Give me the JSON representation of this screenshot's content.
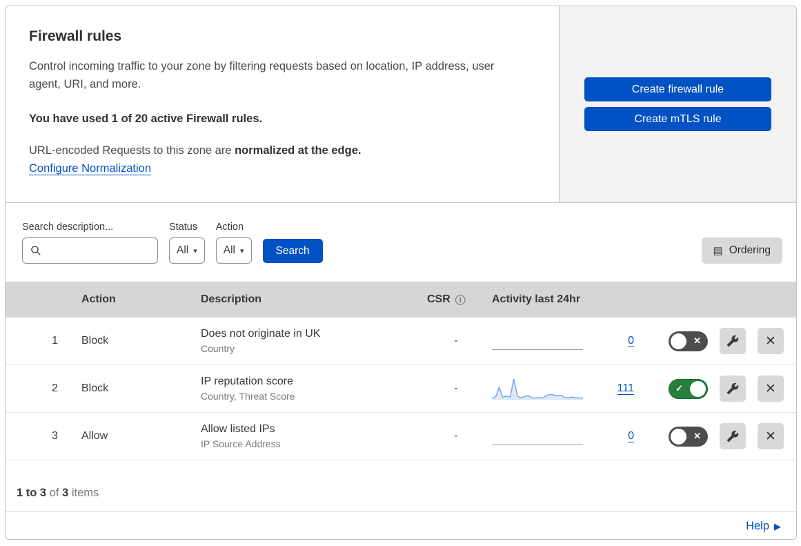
{
  "header": {
    "title": "Firewall rules",
    "description": "Control incoming traffic to your zone by filtering requests based on location, IP address, user agent, URI, and more.",
    "usage_note": "You have used 1 of 20 active Firewall rules.",
    "normalization_prefix": "URL-encoded Requests to this zone are ",
    "normalization_bold": "normalized at the edge.",
    "normalization_link": "Configure Normalization",
    "create_firewall_button": "Create firewall rule",
    "create_mtls_button": "Create mTLS rule"
  },
  "filters": {
    "search_label": "Search description...",
    "status_label": "Status",
    "status_value": "All",
    "action_label": "Action",
    "action_value": "All",
    "search_button": "Search",
    "ordering_button": "Ordering"
  },
  "table": {
    "columns": {
      "action": "Action",
      "description": "Description",
      "csr": "CSR",
      "activity": "Activity last 24hr"
    },
    "rows": [
      {
        "index": "1",
        "action": "Block",
        "description": "Does not originate in UK",
        "criteria": "Country",
        "csr": "-",
        "activity_count": "0",
        "enabled": false
      },
      {
        "index": "2",
        "action": "Block",
        "description": "IP reputation score",
        "criteria": "Country, Threat Score",
        "csr": "-",
        "activity_count": "111",
        "enabled": true
      },
      {
        "index": "3",
        "action": "Allow",
        "description": "Allow listed IPs",
        "criteria": "IP Source Address",
        "csr": "-",
        "activity_count": "0",
        "enabled": false
      }
    ],
    "summary": {
      "range": "1 to 3",
      "of": "of",
      "total": "3",
      "items": "items"
    }
  },
  "footer": {
    "help_label": "Help"
  },
  "chart_data": {
    "type": "area",
    "title": "Activity last 24hr sparkline (rule 2: IP reputation score)",
    "values": [
      4,
      10,
      58,
      8,
      14,
      10,
      100,
      14,
      6,
      12,
      16,
      6,
      4,
      7,
      5,
      17,
      23,
      20,
      16,
      18,
      7,
      5,
      10,
      7,
      5,
      4
    ],
    "total": 111,
    "flat_rows_value": 0
  },
  "icons": {
    "dropdown_arrow": "▾",
    "info": "ⓘ",
    "help_arrow": "▶",
    "toggle_on_check": "✓",
    "toggle_off_cross": "✕",
    "close": "✕",
    "ordering": "▤"
  },
  "colors": {
    "primary_blue": "#0051c3",
    "toggle_on_green": "#26803c",
    "toggle_off_gray": "#4d4d4d",
    "header_gray": "#d6d6d6",
    "panel_gray": "#f2f2f2",
    "sparkline_stroke": "#7ba6e9",
    "sparkline_fill": "rgba(123,166,233,0.25)"
  }
}
